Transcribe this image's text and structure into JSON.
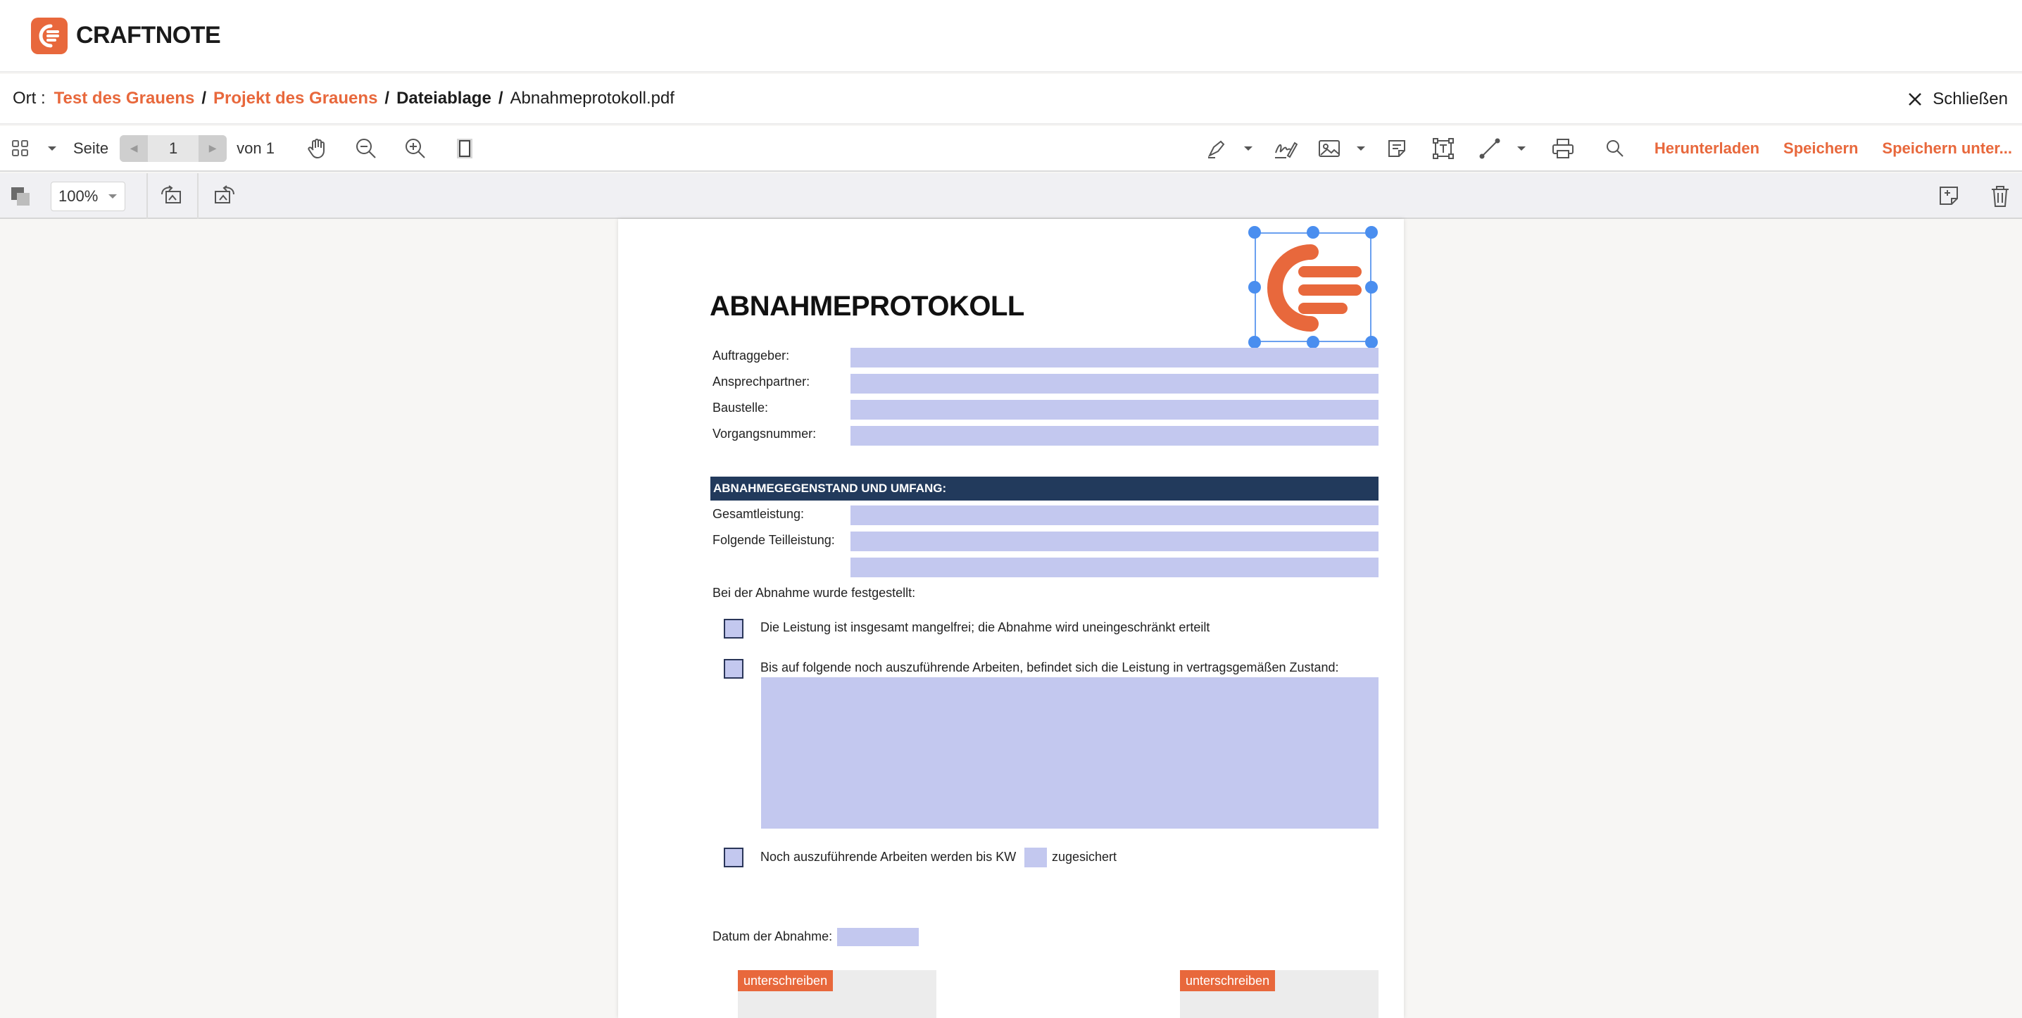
{
  "brand": {
    "name": "CRAFTNOTE"
  },
  "breadcrumb": {
    "label": "Ort :",
    "items": [
      "Test des Grauens",
      "Projekt des Grauens",
      "Dateiablage",
      "Abnahmeprotokoll.pdf"
    ],
    "separator": "/"
  },
  "close_label": "Schließen",
  "toolbar": {
    "page_label": "Seite",
    "page_value": "1",
    "page_of": "von 1",
    "download": "Herunterladen",
    "save": "Speichern",
    "save_as": "Speichern unter..."
  },
  "toolbar2": {
    "zoom": "100%"
  },
  "document": {
    "title": "ABNAHMEPROTOKOLL",
    "fields": [
      "Auftraggeber:",
      "Ansprechpartner:",
      "Baustelle:",
      "Vorgangsnummer:"
    ],
    "section": "ABNAHMEGEGENSTAND UND UMFANG:",
    "scope_fields": [
      "Gesamtleistung:",
      "Folgende Teilleistung:"
    ],
    "intro": "Bei der Abnahme wurde festgestellt:",
    "checks": [
      "Die Leistung ist insgesamt mangelfrei; die Abnahme wird uneingeschränkt erteilt",
      "Bis auf folgende noch auszuführende Arbeiten, befindet sich die Leistung in vertragsgemäßen Zustand:",
      "Noch auszuführende Arbeiten werden bis KW"
    ],
    "assured": "zugesichert",
    "date_label": "Datum der Abnahme:",
    "sign_label": "unterschreiben"
  },
  "colors": {
    "accent": "#e8683c",
    "field": "#c3c8ef",
    "section": "#223a5c",
    "selection": "#4a8eef"
  }
}
